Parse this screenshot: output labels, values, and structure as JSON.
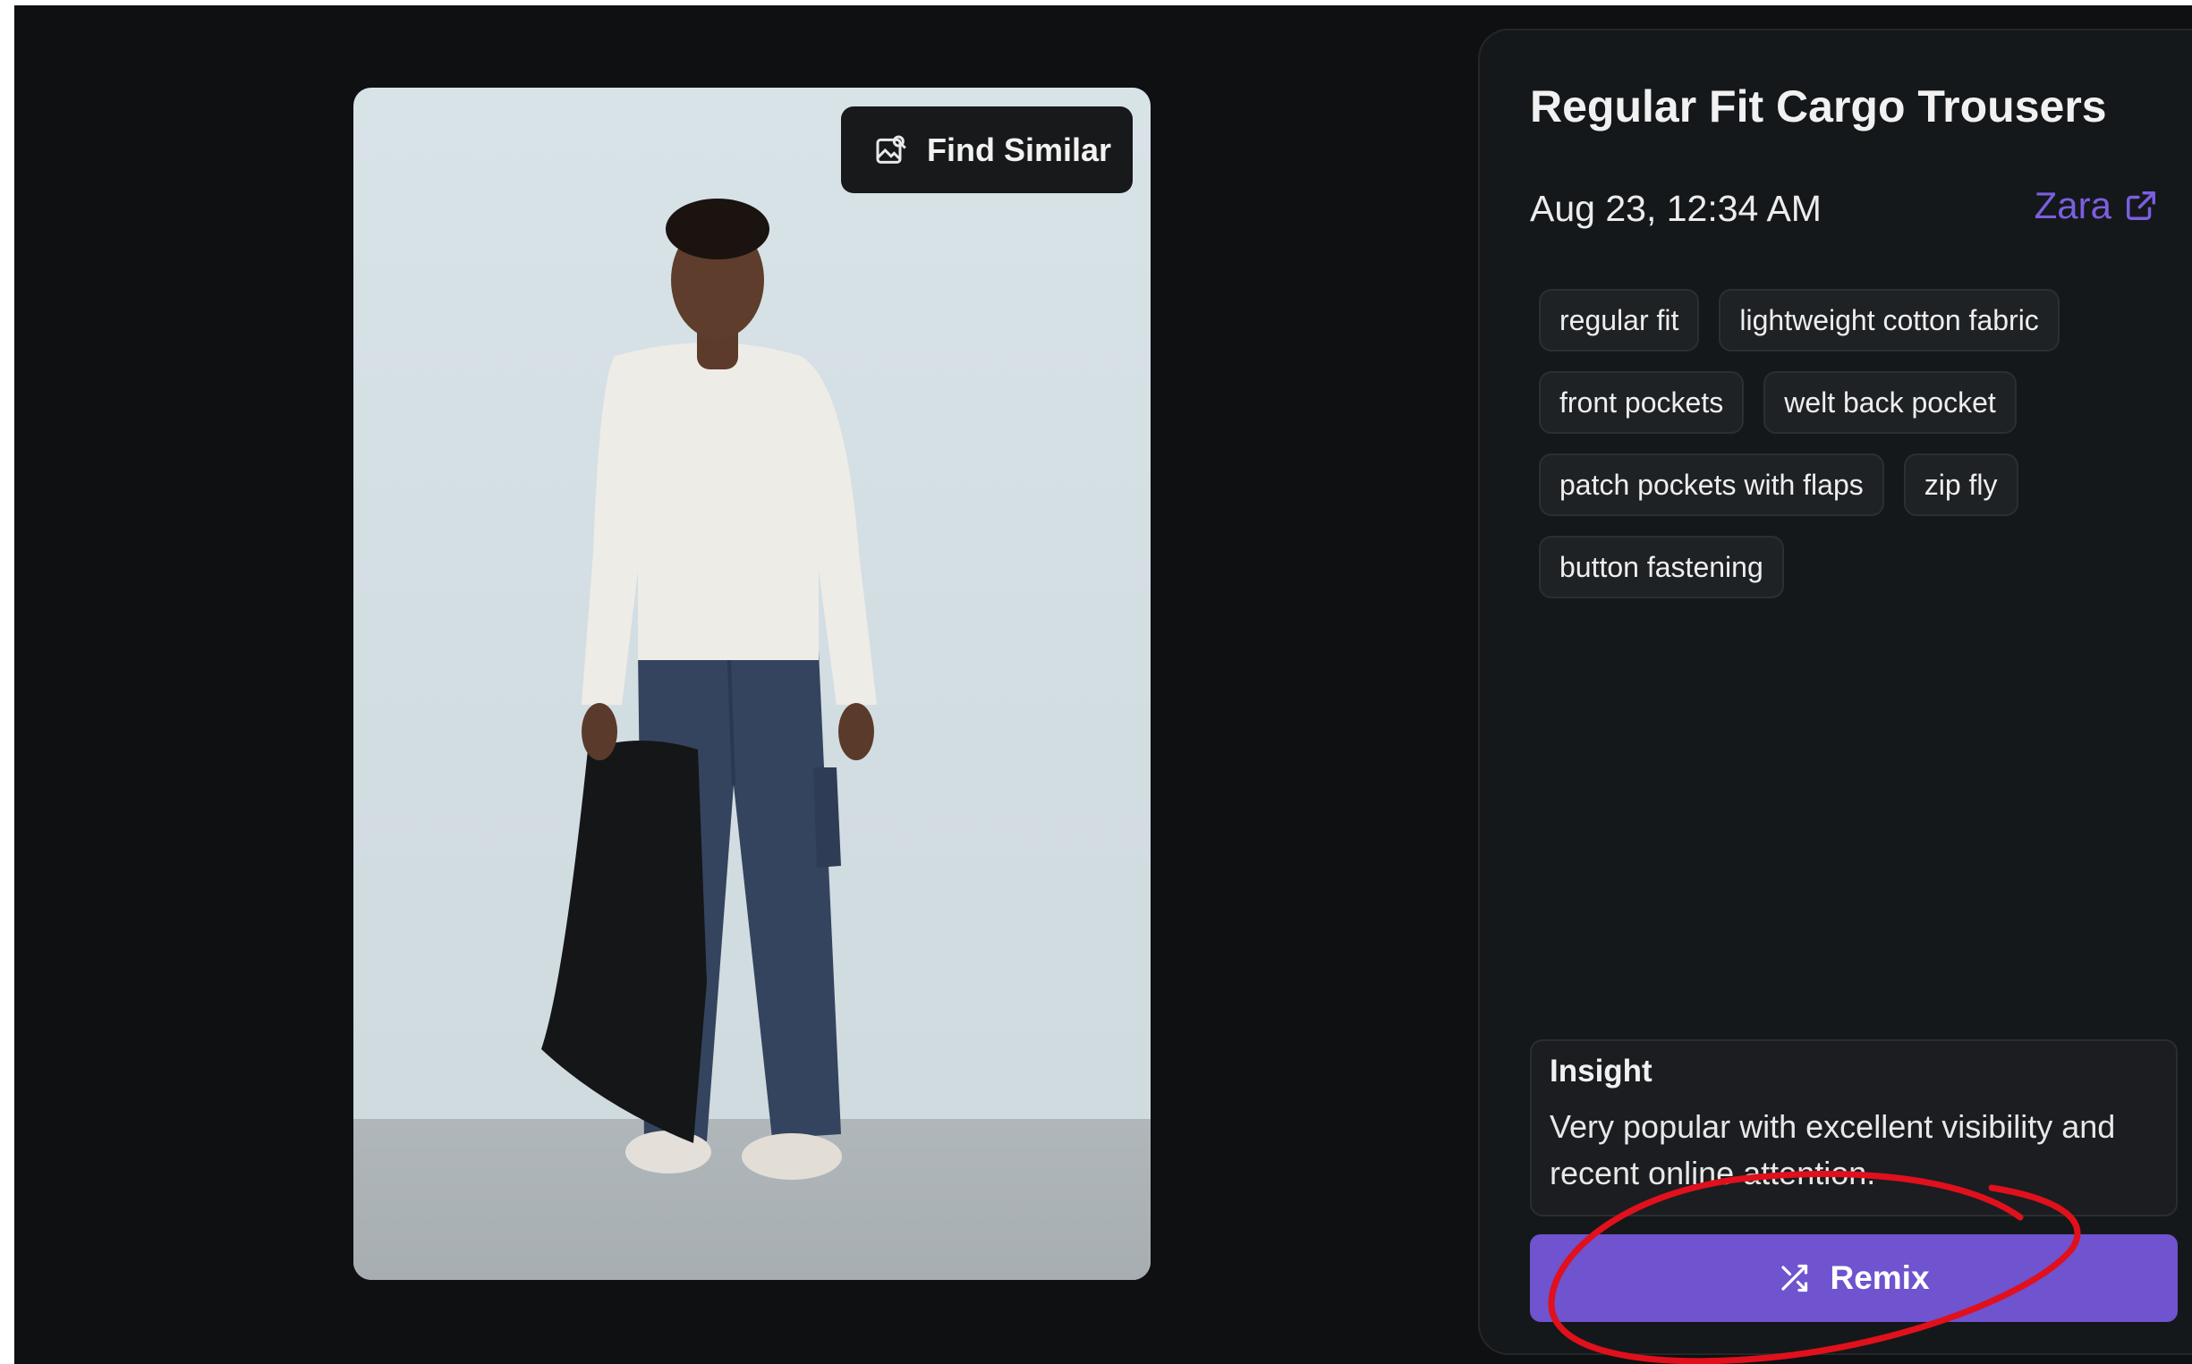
{
  "product": {
    "title": "Regular Fit Cargo Trousers",
    "date": "Aug 23, 12:34 AM",
    "brand": "Zara",
    "tags": [
      "regular fit",
      "lightweight cotton fabric",
      "front pockets",
      "welt back pocket",
      "patch pockets with flaps",
      "zip fly",
      "button fastening"
    ]
  },
  "photo": {
    "find_similar_label": "Find Similar"
  },
  "insight": {
    "heading": "Insight",
    "text": "Very popular with excellent visibility and recent online attention."
  },
  "actions": {
    "remix_label": "Remix"
  },
  "icons": {
    "find_similar": "image-search-icon",
    "brand_link": "external-link-icon",
    "remix": "shuffle-icon"
  },
  "colors": {
    "accent": "#6f53cf",
    "brand_link": "#7b5fe0",
    "annotation": "#e0101c",
    "background": "#0f1011",
    "panel": "#15181a"
  }
}
